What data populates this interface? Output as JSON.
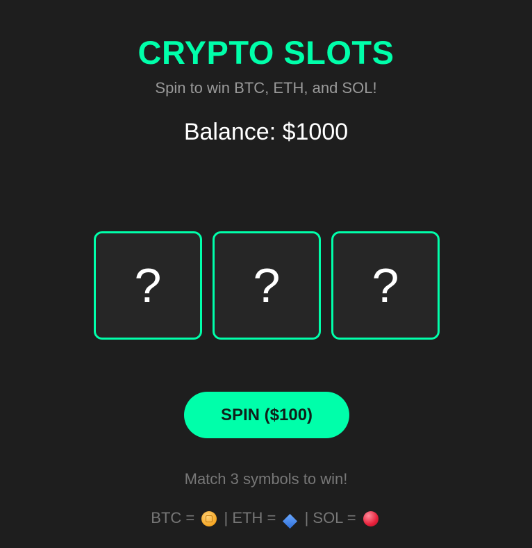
{
  "title": "CRYPTO SLOTS",
  "subtitle": "Spin to win BTC, ETH, and SOL!",
  "balance_text": "Balance: $1000",
  "reels": [
    "?",
    "?",
    "?"
  ],
  "spin_button_label": "SPIN ($100)",
  "hint": "Match 3 symbols to win!",
  "legend": {
    "btc_label": "BTC =",
    "eth_label": "| ETH =",
    "sol_label": "| SOL =",
    "btc_icon": "coin-icon",
    "eth_icon": "blue-diamond-icon",
    "sol_icon": "red-ball-icon"
  },
  "colors": {
    "accent": "#00ffaa",
    "background": "#1e1e1e",
    "reel_background": "#262626"
  }
}
